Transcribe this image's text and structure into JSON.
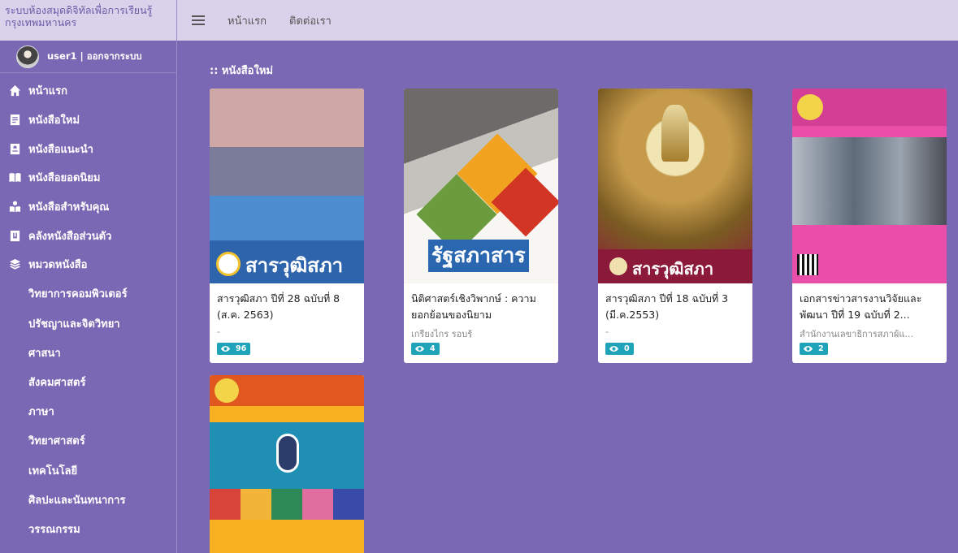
{
  "sidebar": {
    "brand": "ระบบห้องสมุดดิจิทัลเพื่อการเรียนรู้ กรุงเทพมหานคร",
    "user_label": "user1 | ออกจากระบบ",
    "nav": [
      {
        "label": "หน้าแรก",
        "icon": "home-icon"
      },
      {
        "label": "หนังสือใหม่",
        "icon": "book-icon"
      },
      {
        "label": "หนังสือแนะนำ",
        "icon": "bookmark-book-icon"
      },
      {
        "label": "หนังสือยอดนิยม",
        "icon": "open-book-icon"
      },
      {
        "label": "หนังสือสำหรับคุณ",
        "icon": "user-book-icon"
      },
      {
        "label": "คลังหนังสือส่วนตัว",
        "icon": "shelf-icon"
      },
      {
        "label": "หมวดหนังสือ",
        "icon": "layers-icon"
      }
    ],
    "categories": [
      "วิทยาการคอมพิวเตอร์",
      "ปรัชญาและจิตวิทยา",
      "ศาสนา",
      "สังคมศาสตร์",
      "ภาษา",
      "วิทยาศาสตร์",
      "เทคโนโลยี",
      "ศิลปะและนันทนาการ",
      "วรรณกรรม"
    ]
  },
  "topbar": {
    "links": [
      "หน้าแรก",
      "ติดต่อเรา"
    ]
  },
  "main": {
    "section_title": ":: หนังสือใหม่",
    "books": [
      {
        "title": "สารวุฒิสภา ปีที่ 28 ฉบับที่ 8 (ส.ค. 2563)",
        "author": "-",
        "views": "96",
        "cover_text": "สารวุฒิสภา"
      },
      {
        "title": "นิติศาสตร์เชิงวิพากษ์ : ความยอกย้อนของนิยาม",
        "author": "เกรียงไกร รอบรู้",
        "views": "4",
        "cover_text": "รัฐสภาสาร"
      },
      {
        "title": "สารวุฒิสภา ปีที่ 18 ฉบับที่ 3 (มี.ค.2553)",
        "author": "-",
        "views": "0",
        "cover_text": "สารวุฒิสภา"
      },
      {
        "title": "เอกสารข่าวสารงานวิจัยและพัฒนา ปีที่ 19 ฉบับที่ 2...",
        "author": "สำนักงานเลขาธิการสภาผู้แ...",
        "views": "2",
        "cover_text": ""
      },
      {
        "title": "",
        "author": "",
        "views": "",
        "cover_text": ""
      }
    ]
  }
}
